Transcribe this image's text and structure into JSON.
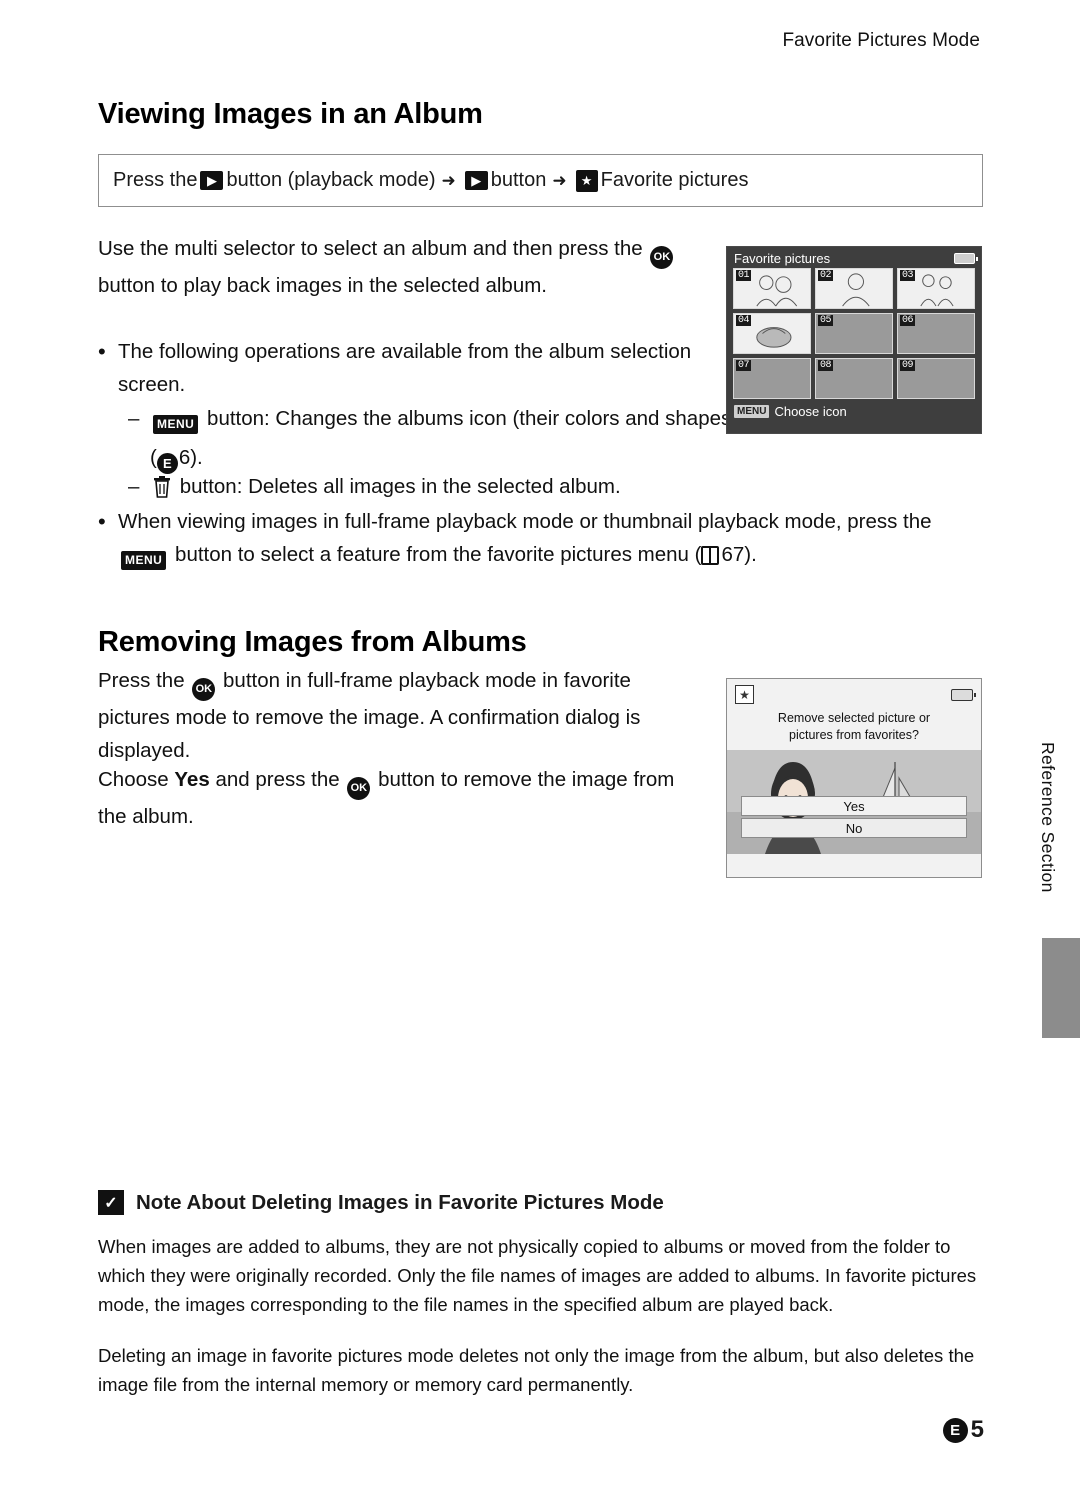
{
  "header": {
    "running_head": "Favorite Pictures Mode"
  },
  "sections": {
    "viewing": {
      "title": "Viewing Images in an Album",
      "path": {
        "prefix": "Press the",
        "play_icon": "play-button-icon",
        "mid1": "button (playback mode)",
        "arrow": "➜",
        "mid2": "button",
        "fav_icon": "favorite-pictures-icon",
        "suffix": "Favorite pictures"
      },
      "intro": "Use the multi selector to select an album and then press the   button to play back images in the selected album.",
      "intro_part1": "Use the multi selector to select an album and then press the",
      "intro_part2": "button to play back images in the selected album.",
      "bullets": [
        {
          "text": "The following operations are available from the album selection screen.",
          "subitems": [
            {
              "icon": "MENU",
              "text_part1": "button: Changes the albums icon (their colors and shapes) (",
              "ref_icon": "E",
              "ref_num": "6",
              "text_part2": ")."
            },
            {
              "icon": "trash-icon",
              "text_part1": "button: Deletes all images in the selected album."
            }
          ]
        },
        {
          "text_part1": "When viewing images in full-frame playback mode or thumbnail playback mode, press the",
          "icon": "MENU",
          "text_part2": "button to select a feature from the favorite pictures menu (",
          "ref_icon": "A",
          "ref_num": "67",
          "text_part3": ")."
        }
      ]
    },
    "removing": {
      "title": "Removing Images from Albums",
      "para1_part1": "Press the",
      "para1_part2": "button in full-frame playback mode in favorite pictures mode to remove the image. A confirmation dialog is displayed.",
      "para2_part1": "Choose",
      "para2_bold": "Yes",
      "para2_part2": "and press the",
      "para2_part3": "button to remove the image from the album."
    }
  },
  "screenshot_album": {
    "title": "Favorite pictures",
    "battery": "battery-icon",
    "cells": [
      {
        "num": "01",
        "filled": true
      },
      {
        "num": "02",
        "filled": true
      },
      {
        "num": "03",
        "filled": true
      },
      {
        "num": "04",
        "filled": true
      },
      {
        "num": "05",
        "filled": false
      },
      {
        "num": "06",
        "filled": false
      },
      {
        "num": "07",
        "filled": false
      },
      {
        "num": "08",
        "filled": false
      },
      {
        "num": "09",
        "filled": false
      }
    ],
    "footer_chip": "MENU",
    "footer_label": "Choose icon"
  },
  "screenshot_confirm": {
    "star": "★",
    "battery": "battery-icon",
    "message_line1": "Remove selected picture or",
    "message_line2": "pictures from favorites?",
    "yes_label": "Yes",
    "no_label": "No"
  },
  "side_tab": {
    "label": "Reference Section"
  },
  "note": {
    "title": "Note About Deleting Images in Favorite Pictures Mode",
    "mark": "✓",
    "paragraphs": [
      "When images are added to albums, they are not physically copied to albums or moved from the folder to which they were originally recorded. Only the file names of images are added to albums. In favorite pictures mode, the images corresponding to the file names in the specified album are played back.",
      "Deleting an image in favorite pictures mode deletes not only the image from the album, but also deletes the image file from the internal memory or memory card permanently."
    ]
  },
  "footer": {
    "prefix": "E",
    "page": "5"
  }
}
